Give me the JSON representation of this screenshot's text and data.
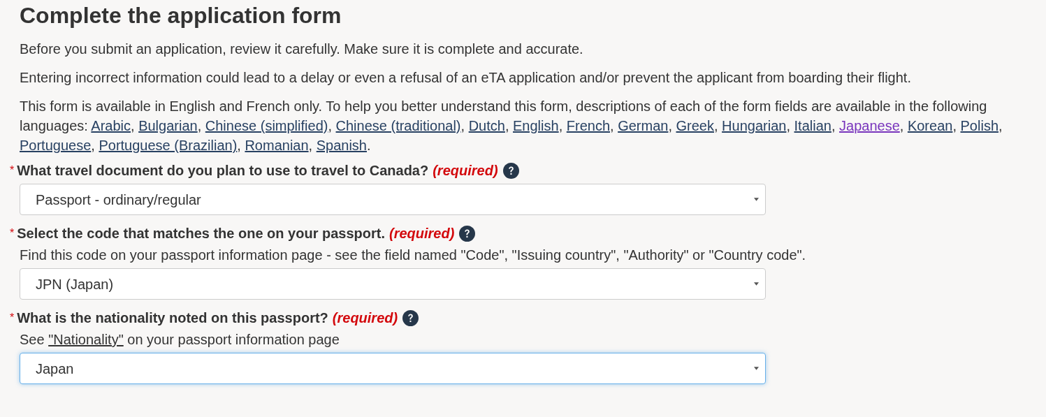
{
  "title": "Complete the application form",
  "intro": [
    "Before you submit an application, review it carefully. Make sure it is complete and accurate.",
    "Entering incorrect information could lead to a delay or even a refusal of an eTA application and/or prevent the applicant from boarding their flight."
  ],
  "languages_text": "This form is available in English and French only. To help you better understand this form, descriptions of each of the form fields are available in the following languages:",
  "languages": [
    {
      "label": "Arabic",
      "visited": false,
      "after": ","
    },
    {
      "label": "Bulgarian",
      "visited": false,
      "after": ","
    },
    {
      "label": "Chinese (simplified)",
      "visited": false,
      "after": ","
    },
    {
      "label": "Chinese (traditional)",
      "visited": false,
      "after": ","
    },
    {
      "label": "Dutch",
      "visited": false,
      "after": ","
    },
    {
      "label": "English",
      "visited": false,
      "after": ","
    },
    {
      "label": "French",
      "visited": false,
      "after": ","
    },
    {
      "label": "German",
      "visited": false,
      "after": ","
    },
    {
      "label": "Greek",
      "visited": false,
      "after": ","
    },
    {
      "label": "Hungarian",
      "visited": false,
      "after": ","
    },
    {
      "label": "Italian",
      "visited": false,
      "after": ","
    },
    {
      "label": "Japanese",
      "visited": true,
      "after": ","
    },
    {
      "label": "Korean",
      "visited": false,
      "after": ","
    },
    {
      "label": "Polish",
      "visited": false,
      "after": ","
    },
    {
      "label": "Portuguese",
      "visited": false,
      "after": ","
    },
    {
      "label": "Portuguese (Brazilian)",
      "visited": false,
      "after": ","
    },
    {
      "label": "Romanian",
      "visited": false,
      "after": ","
    },
    {
      "label": "Spanish",
      "visited": false,
      "after": "."
    }
  ],
  "fields": [
    {
      "marker": "*",
      "question": "What travel document do you plan to use to travel to Canada?",
      "required": "(required)",
      "value": "Passport - ordinary/regular",
      "focused": false
    },
    {
      "marker": "*",
      "question": "Select the code that matches the one on your passport.",
      "required": "(required)",
      "hint_before": "Find this code on your passport information page - see the field named \"Code\", \"Issuing country\", \"Authority\" or \"Country code\".",
      "value": "JPN (Japan)",
      "focused": false
    },
    {
      "marker": "*",
      "question": "What is the nationality noted on this passport?",
      "required": "(required)",
      "hint_before": "See ",
      "hint_link": "\"Nationality\"",
      "hint_after": " on your passport information page",
      "value": "Japan",
      "focused": true
    }
  ]
}
